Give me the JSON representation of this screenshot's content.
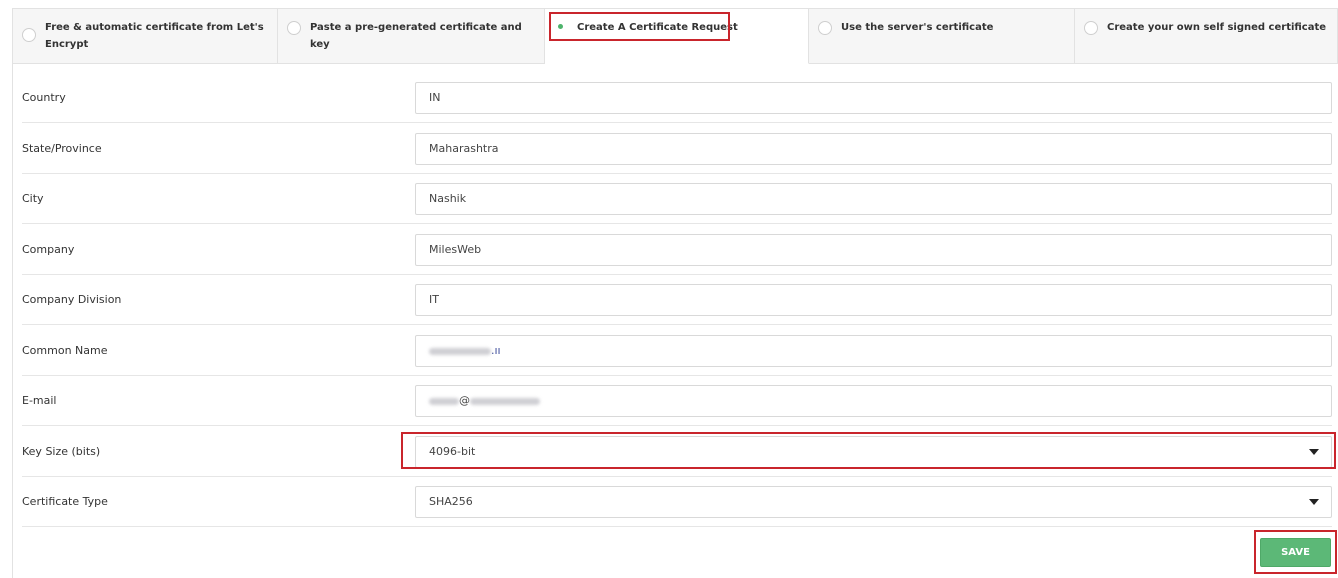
{
  "tabs": [
    {
      "label": "Free & automatic certificate from Let's Encrypt",
      "selected": false
    },
    {
      "label": "Paste a pre-generated certificate and key",
      "selected": false
    },
    {
      "label": "Create A Certificate Request",
      "selected": true
    },
    {
      "label": "Use the server's certificate",
      "selected": false
    },
    {
      "label": "Create your own self signed certificate",
      "selected": false
    }
  ],
  "form": {
    "country": {
      "label": "Country",
      "value": "IN"
    },
    "state": {
      "label": "State/Province",
      "value": "Maharashtra"
    },
    "city": {
      "label": "City",
      "value": "Nashik"
    },
    "company": {
      "label": "Company",
      "value": "MilesWeb"
    },
    "division": {
      "label": "Company Division",
      "value": "IT"
    },
    "common_name": {
      "label": "Common Name",
      "value_suffix": ".ıı"
    },
    "email": {
      "label": "E-mail",
      "value_at": "@"
    },
    "key_size": {
      "label": "Key Size (bits)",
      "value": "4096-bit"
    },
    "cert_type": {
      "label": "Certificate Type",
      "value": "SHA256"
    }
  },
  "save_label": "SAVE",
  "colors": {
    "accent_green": "#5cb877",
    "highlight_red": "#c9252c",
    "radio_dot": "#4db36b"
  }
}
